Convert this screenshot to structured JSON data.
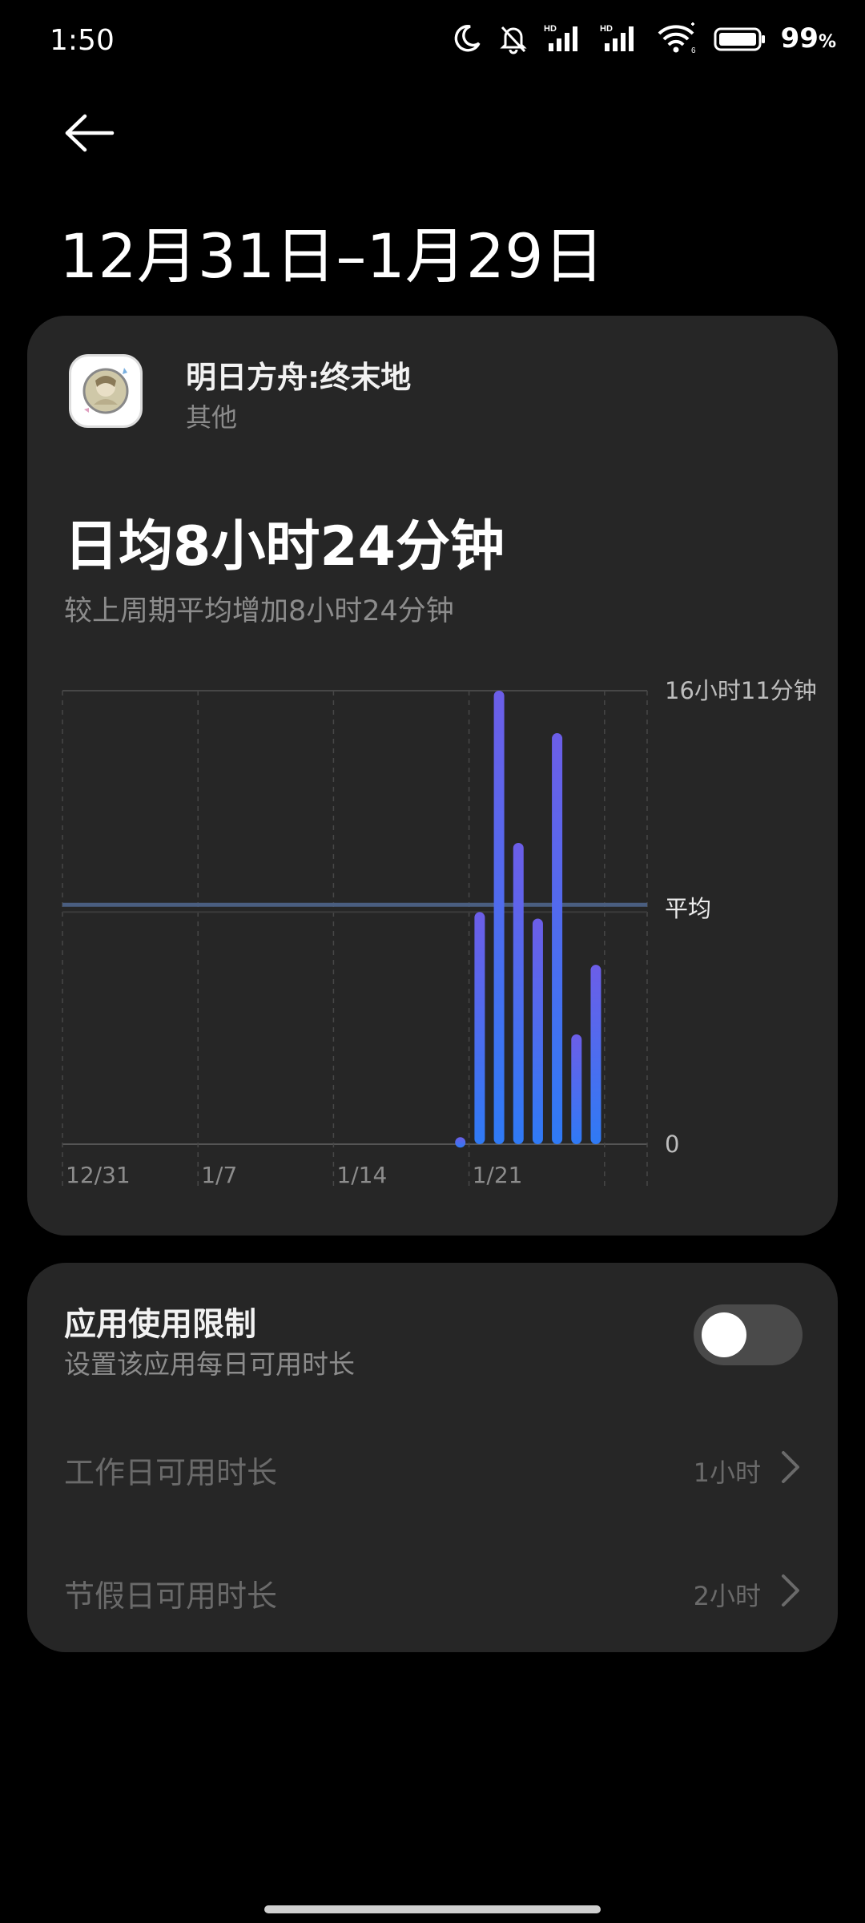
{
  "status_bar": {
    "time": "1:50",
    "icons": [
      "moon-icon",
      "bell-off-icon",
      "signal-hd-icon",
      "signal-hd-icon",
      "wifi-icon",
      "battery-icon"
    ],
    "battery_percent": "99",
    "battery_unit": "%"
  },
  "header": {
    "back_icon": "arrow-left-icon",
    "date_range": "12月31日–1月29日"
  },
  "app": {
    "name": "明日方舟:终末地",
    "category": "其他"
  },
  "summary": {
    "daily_average": "日均8小时24分钟",
    "comparison": "较上周期平均增加8小时24分钟"
  },
  "chart_data": {
    "type": "bar",
    "x_tick_labels": [
      "12/31",
      "1/7",
      "1/14",
      "1/21"
    ],
    "y_labels": {
      "max": "16小时11分钟",
      "average": "平均",
      "min": "0"
    },
    "y_max_minutes": 971,
    "average_minutes": 504,
    "colors": {
      "bar_top": "#6c5ee8",
      "bar_bottom": "#2f7af5",
      "average_line": "#4a5e80"
    },
    "x": [
      "12/31",
      "1/1",
      "1/2",
      "1/3",
      "1/4",
      "1/5",
      "1/6",
      "1/7",
      "1/8",
      "1/9",
      "1/10",
      "1/11",
      "1/12",
      "1/13",
      "1/14",
      "1/15",
      "1/16",
      "1/17",
      "1/18",
      "1/19",
      "1/20",
      "1/21",
      "1/22",
      "1/23",
      "1/24",
      "1/25",
      "1/26",
      "1/27",
      "1/28",
      "1/29"
    ],
    "values": [
      0,
      0,
      0,
      0,
      0,
      0,
      0,
      0,
      0,
      0,
      0,
      0,
      0,
      0,
      0,
      0,
      0,
      0,
      0,
      0,
      15,
      497,
      971,
      645,
      483,
      880,
      235,
      384,
      0,
      0
    ]
  },
  "limit": {
    "title": "应用使用限制",
    "subtitle": "设置该应用每日可用时长",
    "enabled": false,
    "rows": [
      {
        "label": "工作日可用时长",
        "value": "1小时"
      },
      {
        "label": "节假日可用时长",
        "value": "2小时"
      }
    ]
  }
}
